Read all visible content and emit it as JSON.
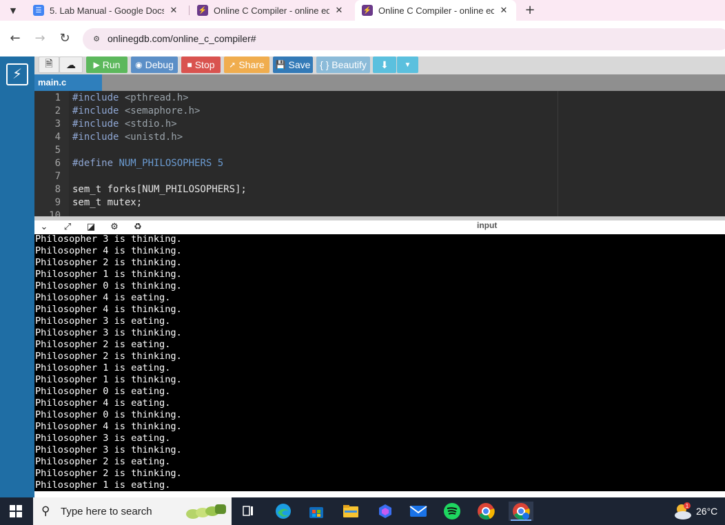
{
  "browser": {
    "tabs": [
      {
        "title": "5. Lab Manual - Google Docs",
        "favicon": "google-docs-icon",
        "active": false
      },
      {
        "title": "Online C Compiler - online edit",
        "favicon": "onlinegdb-icon",
        "active": false
      },
      {
        "title": "Online C Compiler - online edit",
        "favicon": "onlinegdb-icon",
        "active": true
      }
    ],
    "new_tab": "+",
    "url": "onlinegdb.com/online_c_compiler#"
  },
  "toolbar": {
    "run": "Run",
    "debug": "Debug",
    "stop": "Stop",
    "share": "Share",
    "save": "Save",
    "beautify": "{ } Beautify"
  },
  "colors": {
    "run": "#5cb85c",
    "debug": "#5b8fc7",
    "stop": "#d9534f",
    "share": "#f0ad4e",
    "save": "#337ab7",
    "beautify": "#8bbbd9",
    "download": "#5bc0de",
    "sidebar": "#1f6ea5"
  },
  "file_tab": "main.c",
  "editor": {
    "lines": [
      {
        "n": "1",
        "kw": "#include",
        "rest": " <pthread.h>"
      },
      {
        "n": "2",
        "kw": "#include",
        "rest": " <semaphore.h>"
      },
      {
        "n": "3",
        "kw": "#include",
        "rest": " <stdio.h>"
      },
      {
        "n": "4",
        "kw": "#include",
        "rest": " <unistd.h>"
      },
      {
        "n": "5",
        "kw": "",
        "rest": ""
      },
      {
        "n": "6",
        "kw": "#define",
        "rest": " NUM_PHILOSOPHERS 5"
      },
      {
        "n": "7",
        "kw": "",
        "rest": ""
      },
      {
        "n": "8",
        "kw": "",
        "rest": "sem_t forks[NUM_PHILOSOPHERS];"
      },
      {
        "n": "9",
        "kw": "",
        "rest": "sem_t mutex;"
      },
      {
        "n": "10",
        "kw": "",
        "rest": ""
      }
    ]
  },
  "console": {
    "input_label": "input",
    "output": [
      "Philosopher 3 is thinking.",
      "Philosopher 4 is thinking.",
      "Philosopher 2 is thinking.",
      "Philosopher 1 is thinking.",
      "Philosopher 0 is thinking.",
      "Philosopher 4 is eating.",
      "Philosopher 4 is thinking.",
      "Philosopher 3 is eating.",
      "Philosopher 3 is thinking.",
      "Philosopher 2 is eating.",
      "Philosopher 2 is thinking.",
      "Philosopher 1 is eating.",
      "Philosopher 1 is thinking.",
      "Philosopher 0 is eating.",
      "Philosopher 4 is eating.",
      "Philosopher 0 is thinking.",
      "Philosopher 4 is thinking.",
      "Philosopher 3 is eating.",
      "Philosopher 3 is thinking.",
      "Philosopher 2 is eating.",
      "Philosopher 2 is thinking.",
      "Philosopher 1 is eating."
    ]
  },
  "taskbar": {
    "search_placeholder": "Type here to search",
    "weather_badge": "1",
    "temperature": "26°C",
    "apps": [
      "task-view-icon",
      "edge-icon",
      "store-icon",
      "file-explorer-icon",
      "copilot-icon",
      "mail-icon",
      "spotify-icon",
      "chrome-icon",
      "chrome-profile-icon"
    ]
  }
}
